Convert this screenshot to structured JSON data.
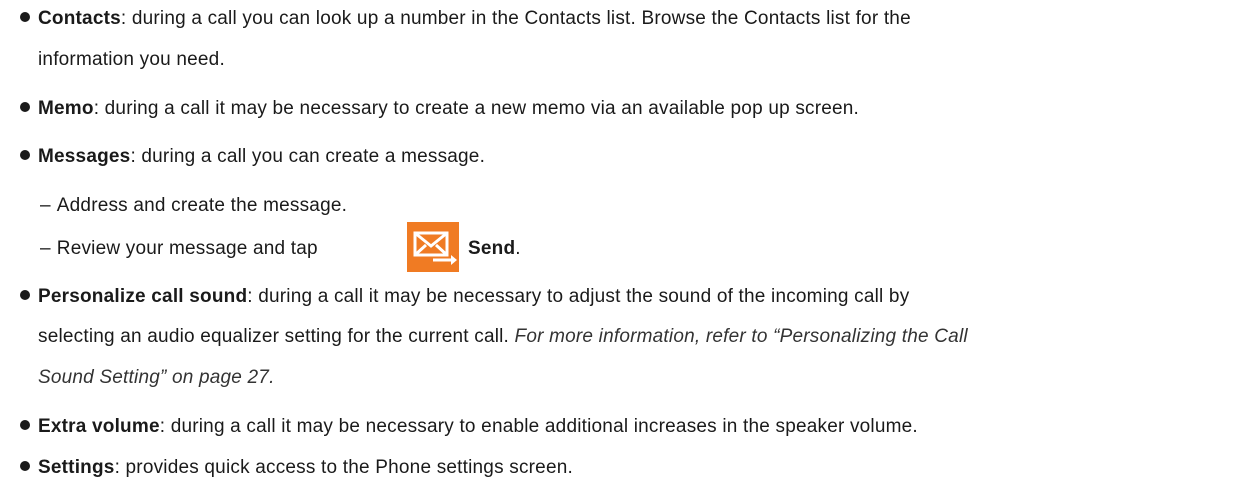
{
  "items": [
    {
      "term": "Contacts",
      "desc_line1": ": during a call you can look up a number in the Contacts list. Browse the Contacts list for the",
      "desc_line2": "information you need."
    },
    {
      "term": "Memo",
      "desc_line1": ": during a call it may be necessary to create a new memo via an available pop up screen."
    },
    {
      "term": "Messages",
      "desc_line1": ": during a call you can create a message.",
      "sub_steps": [
        "Address and create the message.",
        "Review your message and tap"
      ],
      "send_label": "Send",
      "send_suffix": "."
    },
    {
      "term": "Personalize call sound",
      "desc_line1": ": during a call it may be necessary to adjust the sound of the incoming call by",
      "desc_line2": "selecting an audio equalizer setting for the current call.",
      "ref_line2": "For more information, refer to “Personalizing the Call",
      "ref_line3": "Sound Setting” on page 27."
    },
    {
      "term": "Extra volume",
      "desc_line1": ": during a call it may be necessary to enable additional increases in the speaker volume."
    },
    {
      "term": "Settings",
      "desc_line1": ": provides quick access to the Phone settings screen."
    }
  ],
  "dash": "–",
  "icons": {
    "send": "send-message-icon"
  },
  "colors": {
    "send_icon_bg": "#f07b23"
  }
}
